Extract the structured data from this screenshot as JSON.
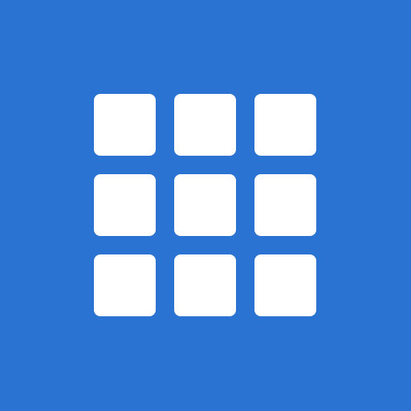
{
  "colors": {
    "background": "#2a73d2",
    "tile": "#ffffff"
  },
  "icon": {
    "name": "app-grid-icon",
    "rows": 3,
    "columns": 3
  }
}
